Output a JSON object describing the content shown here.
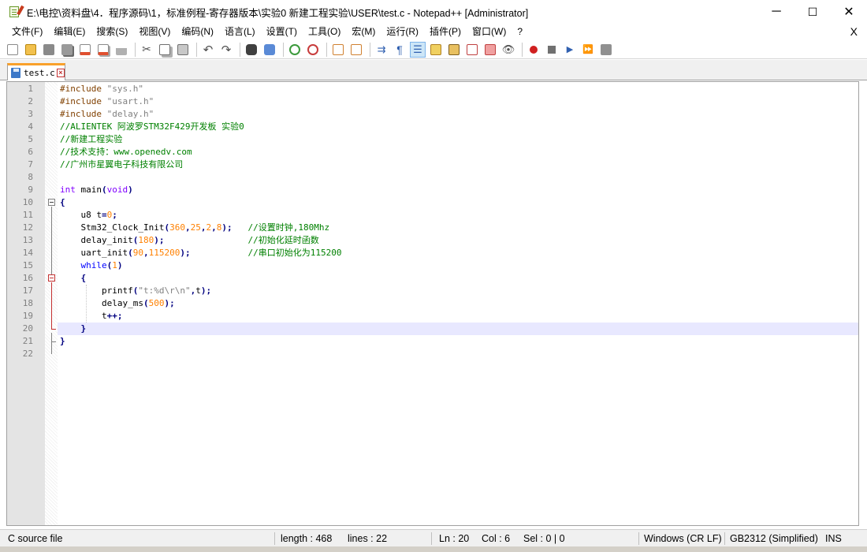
{
  "window": {
    "title": "E:\\电控\\资料盘\\4．程序源码\\1，标准例程-寄存器版本\\实验0 新建工程实验\\USER\\test.c - Notepad++ [Administrator]",
    "minimize": "─",
    "maximize": "☐",
    "close": "✕"
  },
  "menu": {
    "items": [
      "文件(F)",
      "编辑(E)",
      "搜索(S)",
      "视图(V)",
      "编码(N)",
      "语言(L)",
      "设置(T)",
      "工具(O)",
      "宏(M)",
      "运行(R)",
      "插件(P)",
      "窗口(W)",
      "?"
    ],
    "close_doc": "X"
  },
  "toolbar": {
    "buttons": [
      "new-file",
      "open-file",
      "save",
      "save-all",
      "close",
      "close-all",
      "print",
      "cut",
      "copy",
      "paste",
      "undo",
      "redo",
      "find",
      "replace",
      "zoom-in",
      "zoom-out",
      "sync-vertical",
      "sync-horizontal",
      "word-wrap",
      "show-all-chars",
      "indent-guide",
      "user-defined-language",
      "doc-map",
      "function-list",
      "folder-as-workspace",
      "monitoring",
      "record-macro",
      "stop-recording",
      "playback-macro",
      "run-macro-multiple",
      "save-macro"
    ],
    "active_button": "indent-guide"
  },
  "tab": {
    "label": "test.c"
  },
  "editor": {
    "current_line": 20,
    "lines": [
      "#include \"sys.h\"",
      "#include \"usart.h\"",
      "#include \"delay.h\"",
      "//ALIENTEK 阿波罗STM32F429开发板 实验0",
      "//新建工程实验",
      "//技术支持：www.openedv.com",
      "//广州市星翼电子科技有限公司",
      "",
      "int main(void)",
      "{",
      "    u8 t=0;",
      "    Stm32_Clock_Init(360,25,2,8);   //设置时钟,180Mhz",
      "    delay_init(180);                //初始化延时函数",
      "    uart_init(90,115200);           //串口初始化为115200",
      "    while(1)",
      "    {",
      "        printf(\"t:%d\\r\\n\",t);",
      "        delay_ms(500);",
      "        t++;",
      "    }",
      "}",
      ""
    ]
  },
  "status": {
    "file_type": "C source file",
    "length": "length : 468",
    "lines": "lines : 22",
    "ln": "Ln : 20",
    "col": "Col : 6",
    "sel": "Sel : 0 | 0",
    "eol": "Windows (CR LF)",
    "encoding": "GB2312 (Simplified)",
    "mode": "INS"
  }
}
